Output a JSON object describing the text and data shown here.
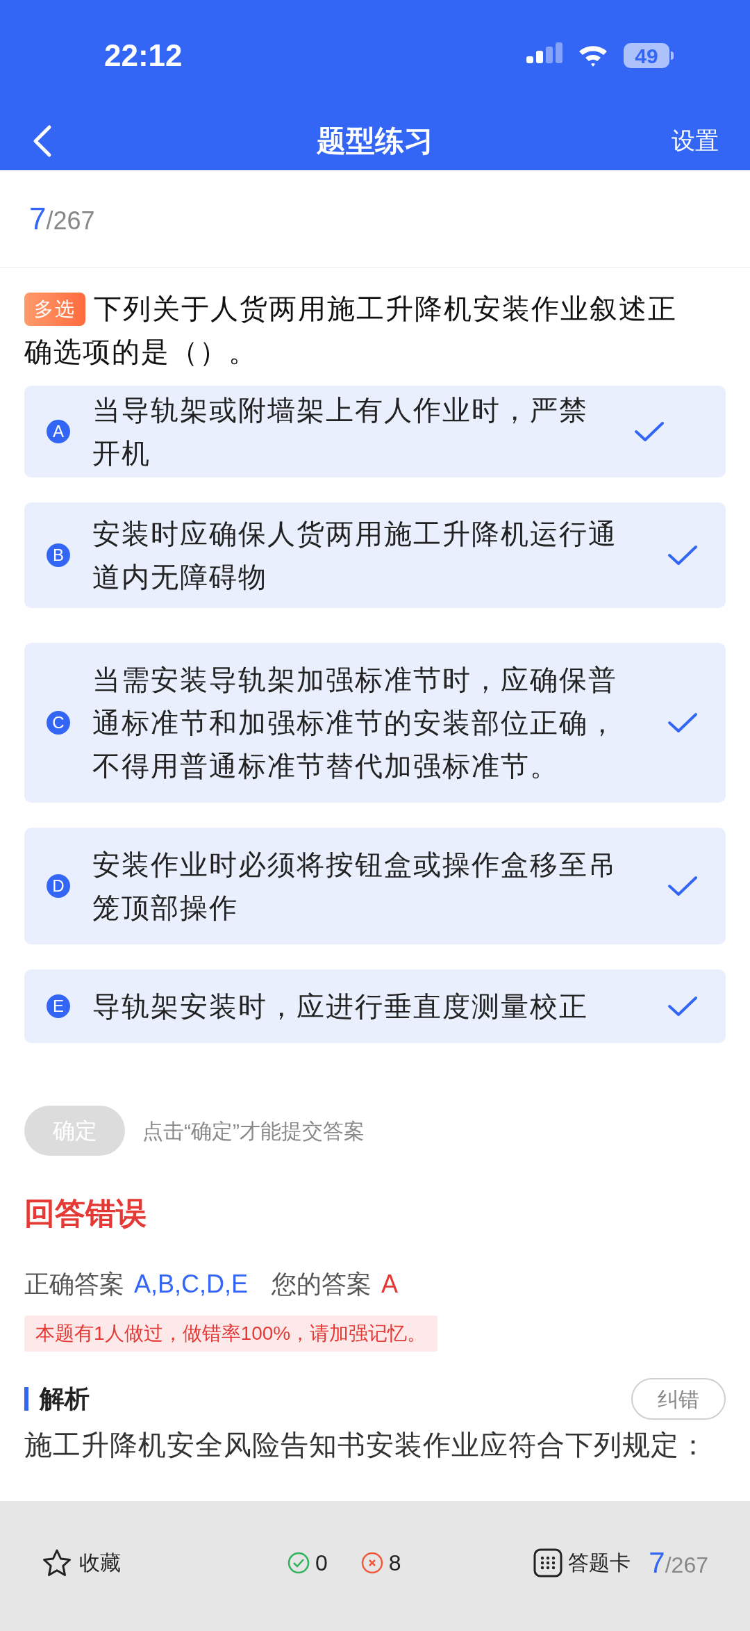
{
  "status_bar": {
    "time": "22:12",
    "battery": "49"
  },
  "nav": {
    "title": "题型练习",
    "action": "设置"
  },
  "counter": {
    "current": "7",
    "total": "/267"
  },
  "question": {
    "tag": "多选",
    "text": "下列关于人货两用施工升降机安装作业叙述正确选项的是（）。"
  },
  "options": [
    {
      "letter": "A",
      "text": "当导轨架或附墙架上有人作业时，严禁开机",
      "checked": true
    },
    {
      "letter": "B",
      "text": "安装时应确保人货两用施工升降机运行通道内无障碍物",
      "checked": true
    },
    {
      "letter": "C",
      "text": "当需安装导轨架加强标准节时，应确保普通标准节和加强标准节的安装部位正确，不得用普通标准节替代加强标准节。",
      "checked": true
    },
    {
      "letter": "D",
      "text": "安装作业时必须将按钮盒或操作盒移至吊笼顶部操作",
      "checked": true
    },
    {
      "letter": "E",
      "text": "导轨架安装时，应进行垂直度测量校正",
      "checked": true
    }
  ],
  "confirm": {
    "button": "确定",
    "disabled": true,
    "hint": "点击“确定”才能提交答案"
  },
  "result": {
    "title": "回答错误",
    "correct_label": "正确答案",
    "correct_value": "A,B,C,D,E",
    "your_label": "您的答案",
    "your_value": "A",
    "note": "本题有1人做过，做错率100%，请加强记忆。"
  },
  "analysis": {
    "title": "解析",
    "report_button": "纠错",
    "text": "施工升降机安全风险告知书安装作业应符合下列规定："
  },
  "bottom_bar": {
    "favorite": "收藏",
    "right_count": "0",
    "wrong_count": "8",
    "answer_card": "答题卡",
    "current": "7",
    "total": "/267"
  }
}
